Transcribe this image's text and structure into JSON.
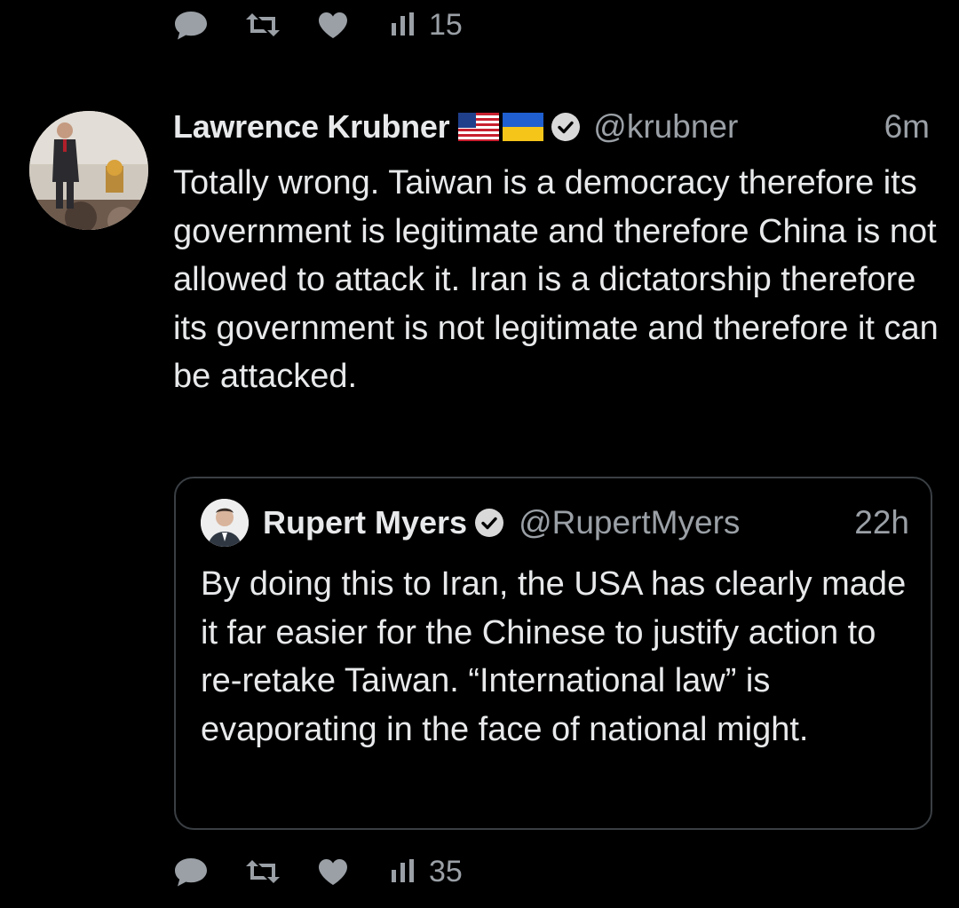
{
  "previous_tweet_actions": {
    "views_count": "15"
  },
  "tweet": {
    "author_name": "Lawrence Krubner",
    "flags": [
      "us-flag",
      "ukraine-flag"
    ],
    "handle": "@krubner",
    "time": "6m",
    "text": "Totally wrong. Taiwan is a democracy therefore its government is legitimate and therefore China is not allowed to attack it. Iran is a dictatorship therefore its government is not legitimate and therefore it can be attacked.",
    "verified": true
  },
  "quoted_tweet": {
    "author_name": "Rupert Myers",
    "handle": "@RupertMyers",
    "time": "22h",
    "text": "By doing this to Iran, the USA has clearly made it far easier for the Chinese to justify action to re-retake Taiwan. “International law” is evaporating in the face of national might.",
    "verified": true
  },
  "tweet_actions": {
    "views_count": "35"
  },
  "icons": [
    "reply-icon",
    "retweet-icon",
    "like-icon",
    "views-icon",
    "verified-icon"
  ],
  "colors": {
    "background": "#000000",
    "primary_text": "#e7e9ea",
    "secondary_text": "#9aa0a6",
    "quote_border": "#3a3f44"
  }
}
